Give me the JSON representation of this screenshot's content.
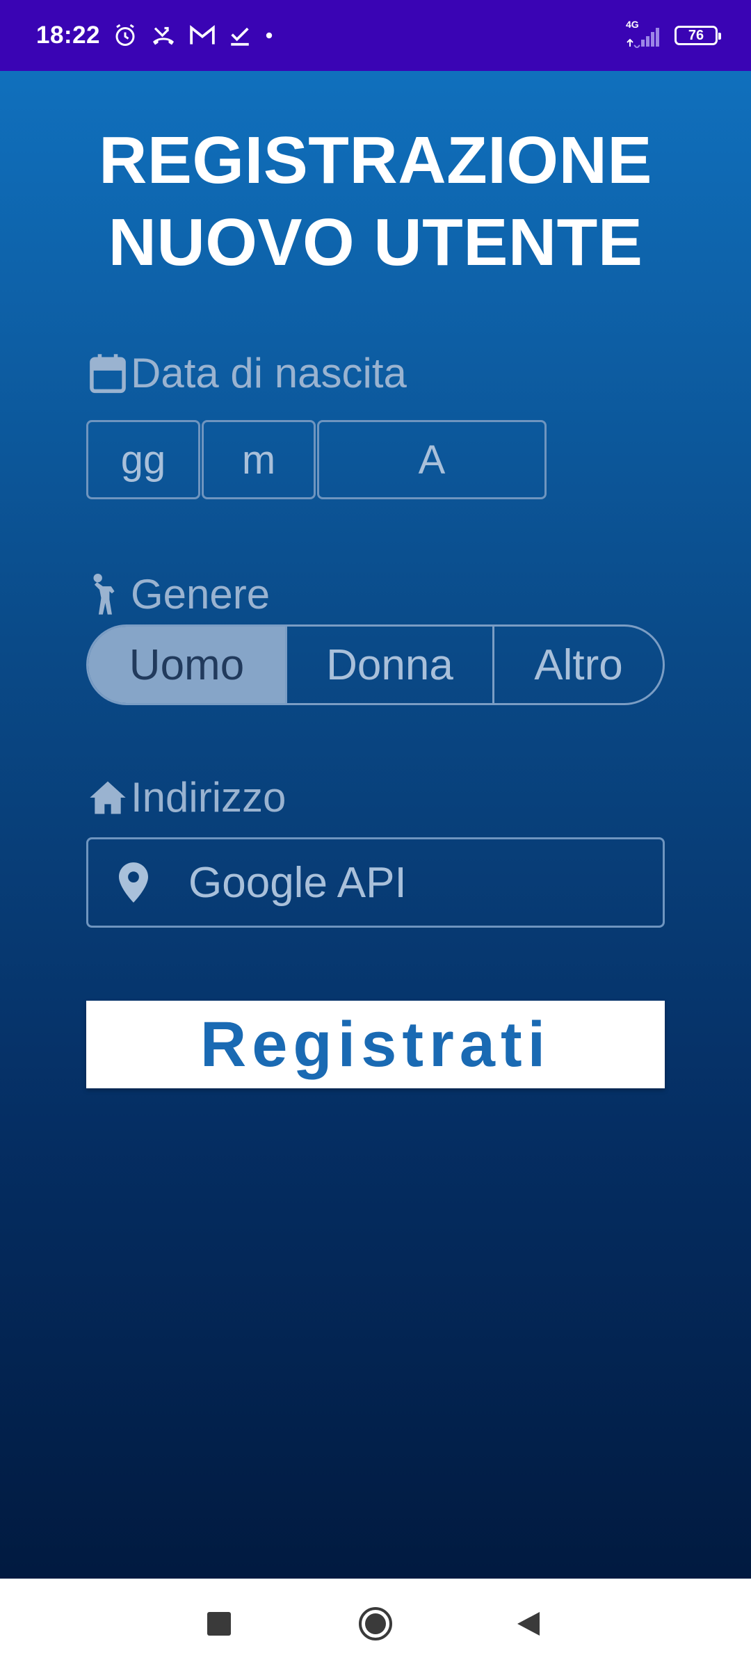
{
  "status_bar": {
    "time": "18:22",
    "icons": [
      "alarm-icon",
      "missed-call-icon",
      "gmail-icon",
      "task-check-icon",
      "dot-icon"
    ],
    "network": "4G",
    "battery": "76"
  },
  "app": {
    "title_line1": "REGISTRAZIONE",
    "title_line2": "NUOVO UTENTE",
    "birth_date": {
      "label": "Data di nascita",
      "icon": "calendar-icon",
      "day_placeholder": "gg",
      "month_placeholder": "m",
      "year_placeholder": "A"
    },
    "gender": {
      "label": "Genere",
      "icon": "person-icon",
      "options": [
        "Uomo",
        "Donna",
        "Altro"
      ],
      "selected": "Uomo"
    },
    "address": {
      "label": "Indirizzo",
      "icon": "home-icon",
      "field_icon": "location-pin-icon",
      "placeholder": "Google API"
    },
    "register_button": "Registrati"
  },
  "nav_bar": {
    "buttons": [
      "recents-icon",
      "home-circle-icon",
      "back-icon"
    ]
  }
}
